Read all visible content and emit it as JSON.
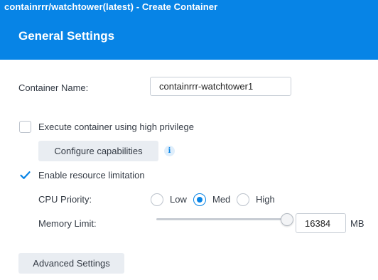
{
  "window": {
    "title": "containrrr/watchtower(latest) - Create Container"
  },
  "section": {
    "title": "General Settings"
  },
  "container_name": {
    "label": "Container Name:",
    "value": "containrrr-watchtower1"
  },
  "high_privilege": {
    "label": "Execute container using high privilege",
    "checked": false
  },
  "capabilities": {
    "button_label": "Configure capabilities",
    "info_icon": "info-icon"
  },
  "resource_limitation": {
    "label": "Enable resource limitation",
    "checked": true
  },
  "cpu_priority": {
    "label": "CPU Priority:",
    "options": [
      "Low",
      "Med",
      "High"
    ],
    "selected": "Med"
  },
  "memory_limit": {
    "label": "Memory Limit:",
    "value": "16384",
    "unit": "MB",
    "slider_fraction": 1.0
  },
  "advanced": {
    "button_label": "Advanced Settings"
  },
  "colors": {
    "accent": "#0784e6",
    "header_text": "#ffffff",
    "button_bg": "#e9edf2"
  }
}
